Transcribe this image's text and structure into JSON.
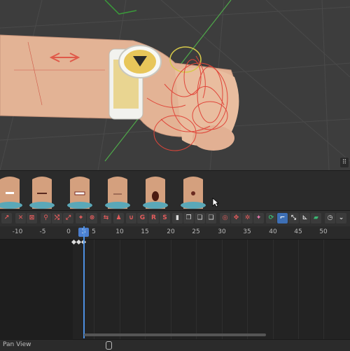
{
  "viewport": {
    "corner_button_icon": "view-toggle-icon"
  },
  "shape_keys": {
    "thumbnail_count": 6
  },
  "ruler": {
    "ticks": [
      "-10",
      "-5",
      "0",
      "5",
      "10",
      "15",
      "20",
      "25",
      "30",
      "35",
      "40",
      "45",
      "50"
    ],
    "current_frame": "3"
  },
  "status_bar": {
    "mode": "Pan View",
    "mouse_icon": "mouse-icon"
  },
  "colors": {
    "accent": "#4c7fcf",
    "keyframe": "#dddddd",
    "toolbar_red": "#e45c5c"
  }
}
